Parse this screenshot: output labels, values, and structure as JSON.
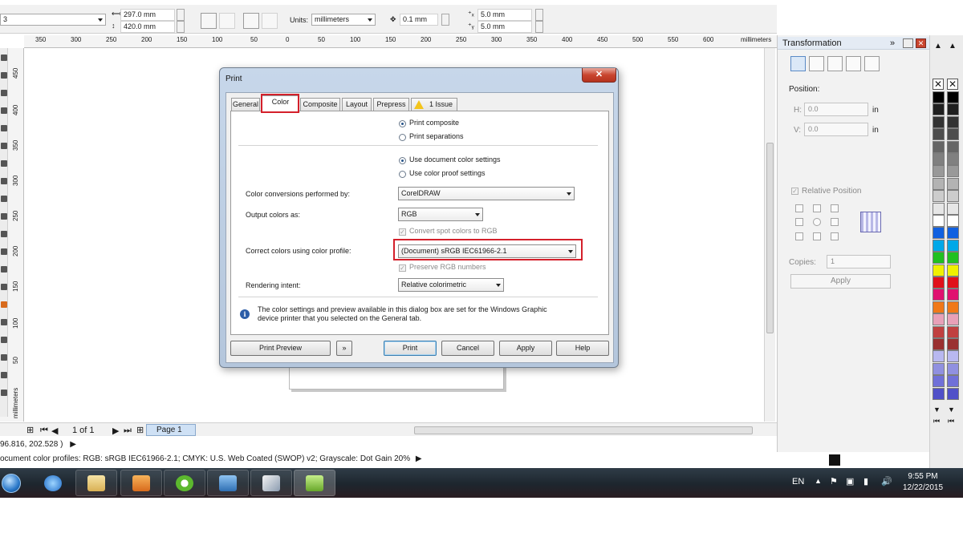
{
  "property_bar": {
    "page_size_value": "3",
    "width": "297.0 mm",
    "height": "420.0 mm",
    "units_label": "Units:",
    "units_value": "millimeters",
    "nudge": "0.1 mm",
    "dup_x": "5.0 mm",
    "dup_y": "5.0 mm"
  },
  "rulers": {
    "horizontal_ticks": [
      "350",
      "300",
      "250",
      "200",
      "150",
      "100",
      "50",
      "0",
      "50",
      "100",
      "150",
      "200",
      "250",
      "300",
      "350",
      "400",
      "450",
      "500",
      "550",
      "600"
    ],
    "horizontal_unit": "millimeters",
    "vertical_ticks": [
      "450",
      "400",
      "350",
      "300",
      "250",
      "200",
      "150",
      "100",
      "50"
    ],
    "vertical_unit": "millimeters"
  },
  "page_nav": {
    "counter": "1 of 1",
    "page_tab": "Page 1"
  },
  "status_bar": {
    "coordinates": "96.816, 202.528 )",
    "color_profiles": "ocument color profiles: RGB: sRGB IEC61966-2.1; CMYK: U.S. Web Coated (SWOP) v2; Grayscale: Dot Gain 20%"
  },
  "docker": {
    "title": "Transformation",
    "position_label": "Position:",
    "h_label": "H:",
    "h_value": "0.0",
    "v_label": "V:",
    "v_value": "0.0",
    "unit": "in",
    "relative_position": "Relative Position",
    "copies_label": "Copies:",
    "copies_value": "1",
    "apply": "Apply"
  },
  "palette": {
    "colors": [
      "#000000",
      "#1f1f1f",
      "#333333",
      "#4d4d4d",
      "#666666",
      "#808080",
      "#999999",
      "#b3b3b3",
      "#cccccc",
      "#e6e6e6",
      "#ffffff",
      "#1060e0",
      "#00a8e8",
      "#20c020",
      "#f0f000",
      "#e0101a",
      "#e01070",
      "#f07818",
      "#e8a0b8",
      "#c04040",
      "#9a3030",
      "#b8b8f0",
      "#9090e0",
      "#7070d8",
      "#5050c8"
    ]
  },
  "dialog": {
    "title": "Print",
    "tabs": [
      "General",
      "Color",
      "Composite",
      "Layout",
      "Prepress",
      "1 Issue"
    ],
    "print_composite": "Print composite",
    "print_separations": "Print separations",
    "use_document_color": "Use document color settings",
    "use_color_proof": "Use color proof settings",
    "conversions_label": "Color conversions performed by:",
    "conversions_value": "CorelDRAW",
    "output_label": "Output colors as:",
    "output_value": "RGB",
    "convert_spot": "Convert spot colors to RGB",
    "correct_label": "Correct colors using color profile:",
    "correct_value": "(Document) sRGB IEC61966-2.1",
    "preserve_rgb": "Preserve RGB numbers",
    "rendering_label": "Rendering intent:",
    "rendering_value": "Relative colorimetric",
    "info": "The color settings and preview available in this dialog box are set for the Windows Graphic\ndevice printer that you selected on the General tab.",
    "buttons": {
      "print_preview": "Print Preview",
      "print": "Print",
      "cancel": "Cancel",
      "apply": "Apply",
      "help": "Help"
    }
  },
  "taskbar": {
    "language": "EN",
    "time": "9:55 PM",
    "date": "12/22/2015",
    "apps": [
      "internet-explorer",
      "file-explorer",
      "media-player",
      "coreldraw-x7",
      "control-panel",
      "paint",
      "corel-launcher"
    ]
  },
  "colors": {
    "highlight": "#d4202b",
    "taskbar": "#1d262e",
    "selected_page_tab": "#cfe1f5"
  }
}
